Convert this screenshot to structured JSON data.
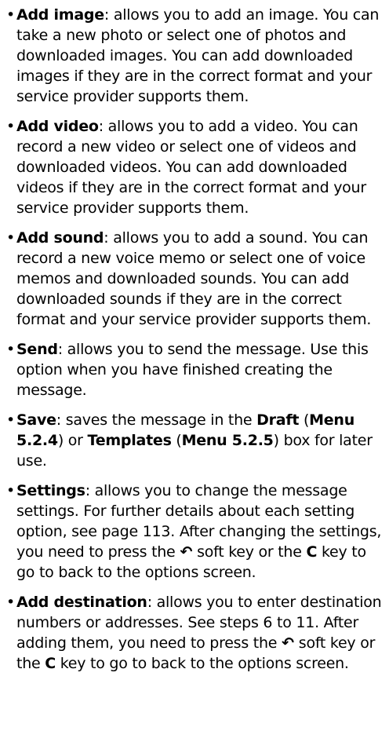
{
  "items": [
    {
      "term": "Add image",
      "text": ": allows you to add an image. You can take a new photo or select one of photos and downloaded images. You can add downloaded images if they are in the correct format and your service provider supports them."
    },
    {
      "term": "Add video",
      "text": ": allows you to add a video. You can record a new video or select one of videos and downloaded videos. You can add downloaded videos if they are in the correct format and your service provider supports them."
    },
    {
      "term": "Add sound",
      "text": ": allows you to add a sound. You can record a new voice memo or select one of voice memos and downloaded sounds. You can add downloaded sounds if they are in the correct format and your service provider supports them."
    },
    {
      "term": "Send",
      "text": ": allows you to send the message. Use this option when you have finished creating the message."
    },
    {
      "term": "Save",
      "t1": ": saves the message in the ",
      "b1": "Draft",
      "t2": " (",
      "b2": "Menu 5.2.4",
      "t3": ") or ",
      "b3": "Templates",
      "t4": " (",
      "b4": "Menu 5.2.5",
      "t5": ") box for later use."
    },
    {
      "term": "Settings",
      "t1": ": allows you to change the message settings. For further details about each setting option, see page 113. After changing the settings, you need to press the ",
      "t2": " soft key or the ",
      "key": "C",
      "t3": " key to go to back to the options screen."
    },
    {
      "term": "Add destination",
      "t1": ": allows you to enter destination numbers or addresses. See steps 6 to 11. After adding them, you need to press the ",
      "t2": " soft key or the ",
      "key": "C",
      "t3": " key to go to back to the options screen."
    }
  ],
  "bullet": "•",
  "softkey_icon": "back-arrow-icon",
  "softkey_glyph": "↶"
}
